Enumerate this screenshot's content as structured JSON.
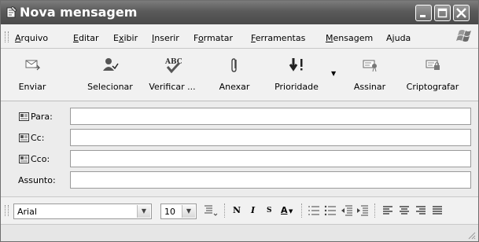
{
  "window": {
    "title": "Nova mensagem"
  },
  "menu": [
    {
      "label": "Arquivo",
      "ul": "A"
    },
    {
      "label": "Editar",
      "ul": "E"
    },
    {
      "label": "Exibir",
      "ul": "x"
    },
    {
      "label": "Inserir",
      "ul": "I"
    },
    {
      "label": "Formatar",
      "ul": "o"
    },
    {
      "label": "Ferramentas",
      "ul": "F"
    },
    {
      "label": "Mensagem",
      "ul": "M"
    },
    {
      "label": "Ajuda",
      "ul": "j"
    }
  ],
  "toolbar": {
    "send": "Enviar",
    "select": "Selecionar",
    "check": "Verificar ...",
    "attach": "Anexar",
    "priority": "Prioridade",
    "sign": "Assinar",
    "encrypt": "Criptografar",
    "check_icon_text": "ABC"
  },
  "fields": {
    "to_label": "Para:",
    "cc_label": "Cc:",
    "bcc_label": "Cco:",
    "subject_label": "Assunto:",
    "to_value": "",
    "cc_value": "",
    "bcc_value": "",
    "subject_value": ""
  },
  "format": {
    "font": "Arial",
    "size": "10",
    "bold": "N",
    "italic": "I",
    "underline": "S",
    "color": "A"
  }
}
